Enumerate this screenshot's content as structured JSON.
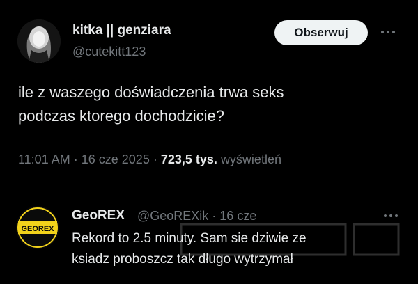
{
  "tweet": {
    "display_name": "kitka || genziara",
    "handle": "@cutekitt123",
    "follow_label": "Obserwuj",
    "text_line1": "ile z waszego doświadczenia trwa seks",
    "text_line2": "podczas ktorego dochodzicie?",
    "time": "11:01 AM",
    "separator": "·",
    "date": "16 cze 2025",
    "views_count": "723,5 tys.",
    "views_label": "wyświetleń"
  },
  "reply": {
    "display_name": "GeoREX",
    "handle_date": "@GeoREXik · 16 cze",
    "avatar_text": "GEOREX",
    "text_line1": "Rekord to 2.5 minuty. Sam sie dziwie ze",
    "text_line2": "ksiadz proboszcz tak długo wytrzymał"
  },
  "colors": {
    "background": "#000000",
    "text_primary": "#e7e9ea",
    "text_secondary": "#71767b",
    "button_bg": "#eff3f4",
    "divider": "#2f3336",
    "georex_yellow": "#f2d21b"
  },
  "icons": {
    "more": "more-horizontal-icon"
  }
}
